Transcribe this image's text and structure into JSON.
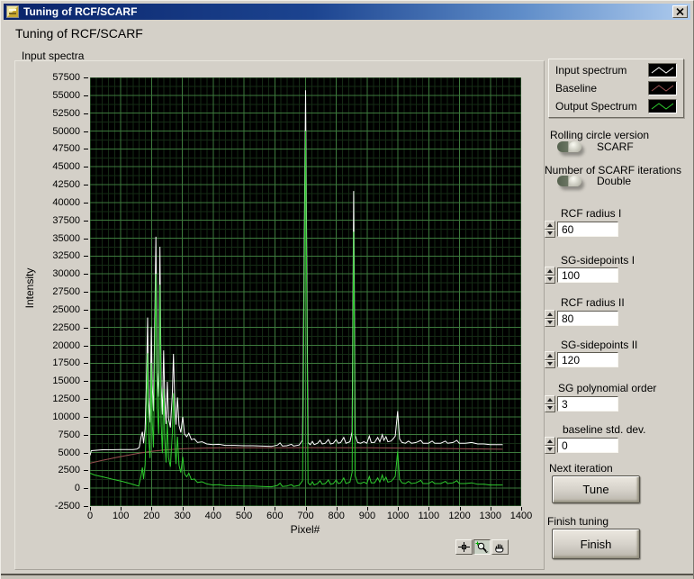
{
  "window": {
    "title": "Tuning of RCF/SCARF"
  },
  "header": {
    "title": "Tuning of RCF/SCARF"
  },
  "chart": {
    "label": "Input spectra",
    "y_axis_label": "Intensity",
    "x_axis_label": "Pixel#"
  },
  "legend": {
    "items": [
      {
        "label": "Input spectrum",
        "color": "#ffffff"
      },
      {
        "label": "Baseline",
        "color": "#9a5252"
      },
      {
        "label": "Output Spectrum",
        "color": "#2ecc2e"
      }
    ]
  },
  "controls": {
    "rolling_circle": {
      "label": "Rolling circle version",
      "value": "SCARF"
    },
    "iterations": {
      "label": "Number of SCARF iterations",
      "value": "Double"
    },
    "numeric_fields": [
      {
        "label": "RCF radius I",
        "value": "60"
      },
      {
        "label": "SG-sidepoints I",
        "value": "100"
      },
      {
        "label": "RCF radius II",
        "value": "80"
      },
      {
        "label": "SG-sidepoints II",
        "value": "120"
      },
      {
        "label": "SG polynomial order",
        "value": "3"
      },
      {
        "label": "baseline std. dev.",
        "value": "0"
      }
    ],
    "next_iteration_label": "Next iteration",
    "tune_button": "Tune",
    "finish_tuning_label": "Finish tuning",
    "finish_button": "Finish"
  },
  "palette": {
    "buttons": [
      "cursor-tool",
      "zoom-tool",
      "pan-tool"
    ]
  },
  "chart_data": {
    "type": "line",
    "title": "Input spectra",
    "xlabel": "Pixel#",
    "ylabel": "Intensity",
    "xlim": [
      0,
      1400
    ],
    "ylim": [
      -2500,
      57500
    ],
    "x_tick_step": 100,
    "y_tick_step": 2500,
    "x_minor_step": 20,
    "y_minor_step": 1250,
    "grid": true,
    "legend_position": "top-right-outside",
    "background": "#000000",
    "grid_major_color": "#3d7a3d",
    "grid_minor_color": "#152b15",
    "series": [
      {
        "name": "Input spectrum",
        "color": "#ffffff",
        "points": [
          [
            0,
            4600
          ],
          [
            4,
            5250
          ],
          [
            40,
            5380
          ],
          [
            100,
            5400
          ],
          [
            140,
            5420
          ],
          [
            152,
            5470
          ],
          [
            160,
            5700
          ],
          [
            166,
            7200
          ],
          [
            170,
            7900
          ],
          [
            174,
            6300
          ],
          [
            179,
            8300
          ],
          [
            183,
            14500
          ],
          [
            187,
            23900
          ],
          [
            190,
            12500
          ],
          [
            195,
            9200
          ],
          [
            199,
            22600
          ],
          [
            202,
            14500
          ],
          [
            206,
            10800
          ],
          [
            211,
            25500
          ],
          [
            214,
            35200
          ],
          [
            218,
            16500
          ],
          [
            223,
            12800
          ],
          [
            227,
            33800
          ],
          [
            231,
            14500
          ],
          [
            235,
            10300
          ],
          [
            239,
            19300
          ],
          [
            243,
            12300
          ],
          [
            247,
            9000
          ],
          [
            251,
            14900
          ],
          [
            255,
            9800
          ],
          [
            261,
            8500
          ],
          [
            267,
            13100
          ],
          [
            271,
            18800
          ],
          [
            275,
            12200
          ],
          [
            279,
            8900
          ],
          [
            284,
            12700
          ],
          [
            289,
            8800
          ],
          [
            295,
            7800
          ],
          [
            301,
            10000
          ],
          [
            307,
            7600
          ],
          [
            314,
            7200
          ],
          [
            321,
            7700
          ],
          [
            329,
            6800
          ],
          [
            339,
            6900
          ],
          [
            349,
            6400
          ],
          [
            364,
            6500
          ],
          [
            379,
            6200
          ],
          [
            399,
            6100
          ],
          [
            419,
            6150
          ],
          [
            439,
            6000
          ],
          [
            469,
            6000
          ],
          [
            499,
            5950
          ],
          [
            529,
            5950
          ],
          [
            559,
            5900
          ],
          [
            589,
            5850
          ],
          [
            609,
            6050
          ],
          [
            617,
            6350
          ],
          [
            625,
            5900
          ],
          [
            639,
            5950
          ],
          [
            654,
            6150
          ],
          [
            661,
            5900
          ],
          [
            679,
            6050
          ],
          [
            690,
            6700
          ],
          [
            700,
            55700
          ],
          [
            708,
            6400
          ],
          [
            715,
            6100
          ],
          [
            722,
            6550
          ],
          [
            728,
            6100
          ],
          [
            739,
            6300
          ],
          [
            747,
            6700
          ],
          [
            754,
            6200
          ],
          [
            764,
            6300
          ],
          [
            774,
            6800
          ],
          [
            781,
            6200
          ],
          [
            790,
            6300
          ],
          [
            799,
            6800
          ],
          [
            806,
            6300
          ],
          [
            814,
            6400
          ],
          [
            824,
            7100
          ],
          [
            831,
            6300
          ],
          [
            844,
            6500
          ],
          [
            851,
            7900
          ],
          [
            856,
            41600
          ],
          [
            861,
            7400
          ],
          [
            869,
            6400
          ],
          [
            879,
            6300
          ],
          [
            889,
            6500
          ],
          [
            899,
            6300
          ],
          [
            907,
            7300
          ],
          [
            913,
            6400
          ],
          [
            924,
            6400
          ],
          [
            934,
            7100
          ],
          [
            941,
            6500
          ],
          [
            949,
            7500
          ],
          [
            954,
            6700
          ],
          [
            961,
            7200
          ],
          [
            967,
            6500
          ],
          [
            977,
            6600
          ],
          [
            984,
            6900
          ],
          [
            991,
            7300
          ],
          [
            999,
            10800
          ],
          [
            1005,
            6900
          ],
          [
            1013,
            6400
          ],
          [
            1024,
            6300
          ],
          [
            1034,
            6600
          ],
          [
            1044,
            6300
          ],
          [
            1059,
            6400
          ],
          [
            1074,
            6700
          ],
          [
            1081,
            6300
          ],
          [
            1099,
            6300
          ],
          [
            1111,
            6600
          ],
          [
            1119,
            6300
          ],
          [
            1139,
            6300
          ],
          [
            1154,
            6600
          ],
          [
            1161,
            6300
          ],
          [
            1179,
            6400
          ],
          [
            1191,
            6700
          ],
          [
            1199,
            6300
          ],
          [
            1219,
            6300
          ],
          [
            1239,
            6400
          ],
          [
            1259,
            6200
          ],
          [
            1279,
            6200
          ],
          [
            1299,
            6100
          ],
          [
            1319,
            6100
          ],
          [
            1340,
            6100
          ]
        ]
      },
      {
        "name": "Baseline",
        "color": "#9a5252",
        "points": [
          [
            0,
            3500
          ],
          [
            40,
            3900
          ],
          [
            80,
            4250
          ],
          [
            120,
            4600
          ],
          [
            160,
            4900
          ],
          [
            200,
            5150
          ],
          [
            240,
            5350
          ],
          [
            280,
            5480
          ],
          [
            320,
            5560
          ],
          [
            380,
            5620
          ],
          [
            440,
            5650
          ],
          [
            520,
            5660
          ],
          [
            600,
            5670
          ],
          [
            700,
            5680
          ],
          [
            800,
            5670
          ],
          [
            900,
            5650
          ],
          [
            1000,
            5620
          ],
          [
            1100,
            5580
          ],
          [
            1200,
            5530
          ],
          [
            1280,
            5490
          ],
          [
            1340,
            5460
          ]
        ]
      },
      {
        "name": "Output Spectrum",
        "color": "#2ecc2e",
        "points": [
          [
            0,
            2100
          ],
          [
            15,
            1850
          ],
          [
            45,
            1550
          ],
          [
            75,
            1250
          ],
          [
            105,
            950
          ],
          [
            130,
            650
          ],
          [
            150,
            400
          ],
          [
            158,
            300
          ],
          [
            165,
            1600
          ],
          [
            170,
            2900
          ],
          [
            174,
            1300
          ],
          [
            179,
            3300
          ],
          [
            183,
            9500
          ],
          [
            187,
            18900
          ],
          [
            190,
            7500
          ],
          [
            195,
            4200
          ],
          [
            199,
            17500
          ],
          [
            202,
            9400
          ],
          [
            206,
            5700
          ],
          [
            211,
            20400
          ],
          [
            214,
            30000
          ],
          [
            218,
            11300
          ],
          [
            223,
            7600
          ],
          [
            227,
            28500
          ],
          [
            231,
            9200
          ],
          [
            235,
            4900
          ],
          [
            239,
            13900
          ],
          [
            243,
            6900
          ],
          [
            247,
            3600
          ],
          [
            251,
            9500
          ],
          [
            255,
            4300
          ],
          [
            261,
            3000
          ],
          [
            267,
            7600
          ],
          [
            271,
            13300
          ],
          [
            275,
            6700
          ],
          [
            279,
            3400
          ],
          [
            284,
            7200
          ],
          [
            289,
            3200
          ],
          [
            295,
            2200
          ],
          [
            301,
            4400
          ],
          [
            307,
            2000
          ],
          [
            314,
            1600
          ],
          [
            321,
            2100
          ],
          [
            329,
            1200
          ],
          [
            339,
            1300
          ],
          [
            349,
            800
          ],
          [
            364,
            900
          ],
          [
            379,
            600
          ],
          [
            399,
            450
          ],
          [
            419,
            500
          ],
          [
            439,
            350
          ],
          [
            469,
            350
          ],
          [
            499,
            300
          ],
          [
            529,
            300
          ],
          [
            559,
            250
          ],
          [
            589,
            200
          ],
          [
            609,
            400
          ],
          [
            617,
            700
          ],
          [
            625,
            250
          ],
          [
            639,
            300
          ],
          [
            654,
            500
          ],
          [
            661,
            250
          ],
          [
            679,
            400
          ],
          [
            690,
            1050
          ],
          [
            700,
            50000
          ],
          [
            708,
            750
          ],
          [
            715,
            450
          ],
          [
            722,
            900
          ],
          [
            728,
            450
          ],
          [
            739,
            650
          ],
          [
            747,
            1050
          ],
          [
            754,
            550
          ],
          [
            764,
            650
          ],
          [
            774,
            1150
          ],
          [
            781,
            550
          ],
          [
            790,
            650
          ],
          [
            799,
            1150
          ],
          [
            806,
            650
          ],
          [
            814,
            750
          ],
          [
            824,
            1450
          ],
          [
            831,
            650
          ],
          [
            844,
            850
          ],
          [
            851,
            2250
          ],
          [
            856,
            35900
          ],
          [
            861,
            1750
          ],
          [
            869,
            750
          ],
          [
            879,
            650
          ],
          [
            889,
            850
          ],
          [
            899,
            650
          ],
          [
            907,
            1650
          ],
          [
            913,
            750
          ],
          [
            924,
            750
          ],
          [
            934,
            1450
          ],
          [
            941,
            850
          ],
          [
            949,
            1850
          ],
          [
            954,
            1050
          ],
          [
            961,
            1550
          ],
          [
            967,
            850
          ],
          [
            977,
            950
          ],
          [
            984,
            1250
          ],
          [
            991,
            1650
          ],
          [
            999,
            5150
          ],
          [
            1005,
            1250
          ],
          [
            1013,
            750
          ],
          [
            1024,
            650
          ],
          [
            1034,
            950
          ],
          [
            1044,
            650
          ],
          [
            1059,
            750
          ],
          [
            1074,
            1100
          ],
          [
            1081,
            650
          ],
          [
            1099,
            650
          ],
          [
            1111,
            950
          ],
          [
            1119,
            650
          ],
          [
            1139,
            650
          ],
          [
            1154,
            950
          ],
          [
            1161,
            650
          ],
          [
            1179,
            750
          ],
          [
            1191,
            1050
          ],
          [
            1199,
            650
          ],
          [
            1219,
            650
          ],
          [
            1239,
            750
          ],
          [
            1259,
            550
          ],
          [
            1279,
            550
          ],
          [
            1299,
            450
          ],
          [
            1319,
            450
          ],
          [
            1340,
            450
          ]
        ]
      }
    ]
  }
}
